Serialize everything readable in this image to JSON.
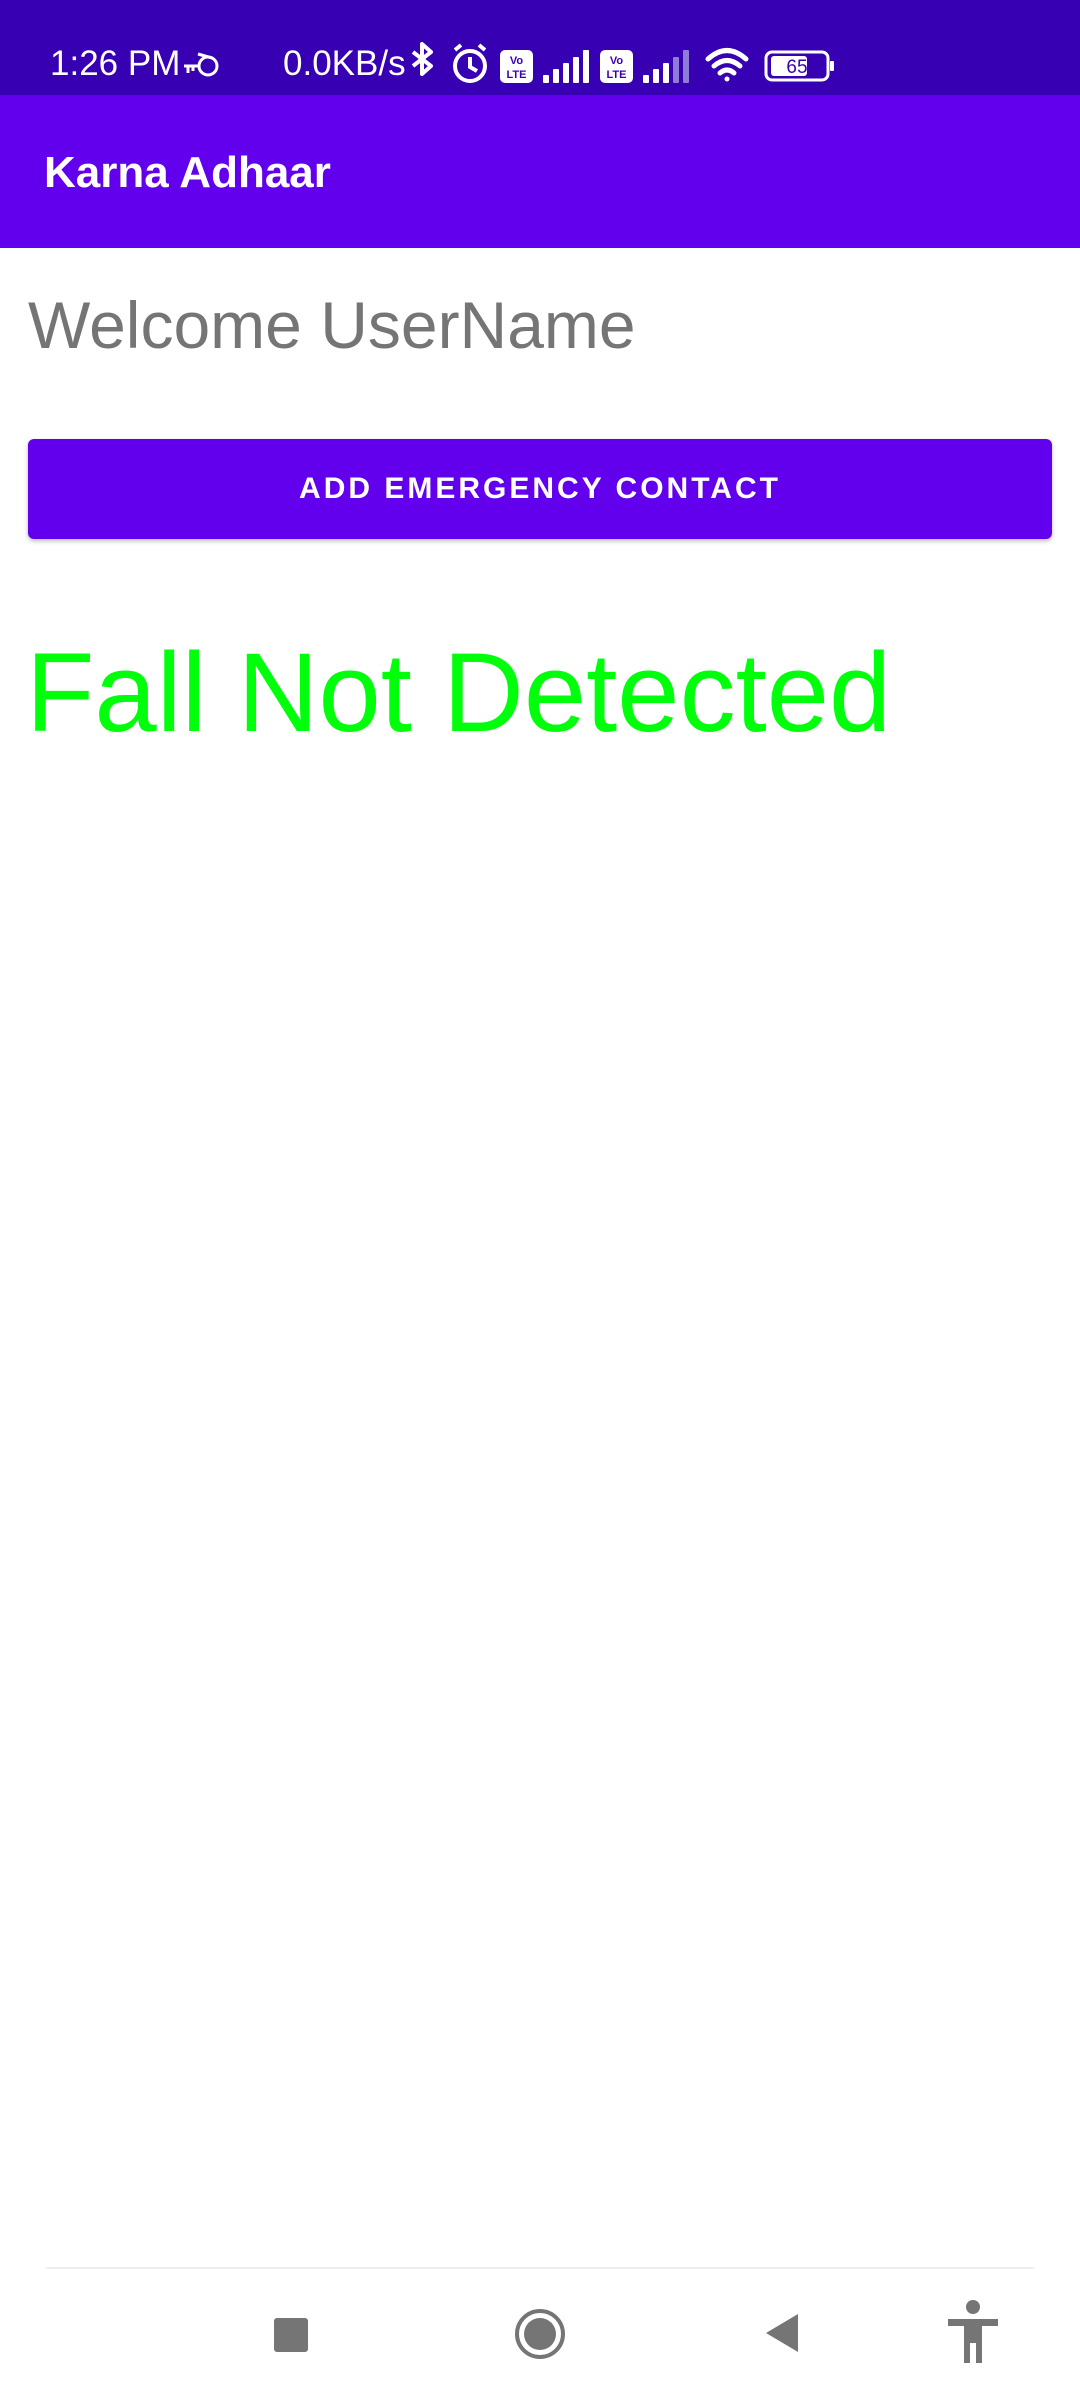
{
  "status_bar": {
    "time": "1:26 PM",
    "network_speed": "0.0KB/s",
    "battery_level": "65",
    "icons": [
      "vpn-key-icon",
      "bluetooth-icon",
      "alarm-icon",
      "volte-icon",
      "signal-icon",
      "volte-icon",
      "signal-icon",
      "wifi-icon",
      "battery-icon"
    ],
    "background_color": "#3700B3"
  },
  "app_bar": {
    "title": "Karna Adhaar",
    "background_color": "#6200EE"
  },
  "main": {
    "welcome_text": "Welcome UserName",
    "emergency_button_label": "ADD EMERGENCY CONTACT",
    "fall_status_text": "Fall Not Detected",
    "fall_status_color": "#00FF0A"
  },
  "nav_bar": {
    "buttons": [
      "recents-icon",
      "home-icon",
      "back-icon",
      "accessibility-icon"
    ]
  }
}
